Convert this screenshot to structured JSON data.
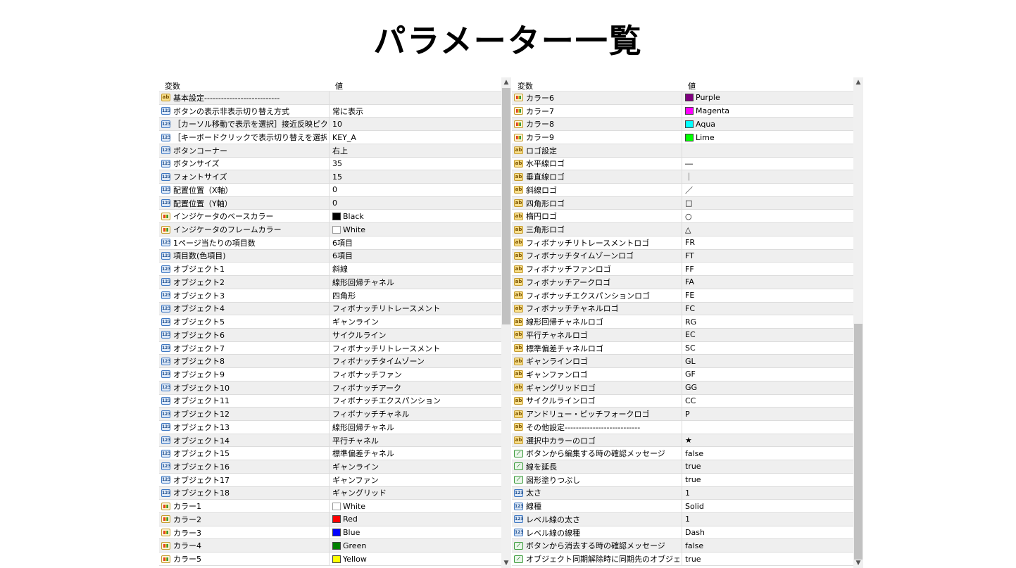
{
  "title": "パラメーター一覧",
  "header": {
    "col1": "変数",
    "col2": "値"
  },
  "left_rows": [
    {
      "icon": "ab",
      "name": "基本設定---------------------------",
      "value": ""
    },
    {
      "icon": "num",
      "name": "ボタンの表示非表示切り替え方式",
      "value": "常に表示"
    },
    {
      "icon": "num",
      "name": "［カーソル移動で表示を選択］接近反映ピク･..",
      "value": "10"
    },
    {
      "icon": "num",
      "name": "［キーボードクリックで表示切り替えを選択］キ･..",
      "value": "KEY_A"
    },
    {
      "icon": "num",
      "name": "ボタンコーナー",
      "value": "右上"
    },
    {
      "icon": "num",
      "name": "ボタンサイズ",
      "value": "35"
    },
    {
      "icon": "num",
      "name": "フォントサイズ",
      "value": "15"
    },
    {
      "icon": "num",
      "name": "配置位置（X軸）",
      "value": "0"
    },
    {
      "icon": "num",
      "name": "配置位置（Y軸）",
      "value": "0"
    },
    {
      "icon": "col",
      "name": "インジケータのベースカラー",
      "value": "Black",
      "swatch": "#000000"
    },
    {
      "icon": "col",
      "name": "インジケータのフレームカラー",
      "value": "White",
      "swatch": "#ffffff"
    },
    {
      "icon": "num",
      "name": "1ページ当たりの項目数",
      "value": "6項目"
    },
    {
      "icon": "num",
      "name": "項目数(色項目)",
      "value": "6項目"
    },
    {
      "icon": "num",
      "name": "オブジェクト1",
      "value": "斜線"
    },
    {
      "icon": "num",
      "name": "オブジェクト2",
      "value": "線形回帰チャネル"
    },
    {
      "icon": "num",
      "name": "オブジェクト3",
      "value": "四角形"
    },
    {
      "icon": "num",
      "name": "オブジェクト4",
      "value": "フィボナッチリトレースメント"
    },
    {
      "icon": "num",
      "name": "オブジェクト5",
      "value": "ギャンライン"
    },
    {
      "icon": "num",
      "name": "オブジェクト6",
      "value": "サイクルライン"
    },
    {
      "icon": "num",
      "name": "オブジェクト7",
      "value": "フィボナッチリトレースメント"
    },
    {
      "icon": "num",
      "name": "オブジェクト8",
      "value": "フィボナッチタイムゾーン"
    },
    {
      "icon": "num",
      "name": "オブジェクト9",
      "value": "フィボナッチファン"
    },
    {
      "icon": "num",
      "name": "オブジェクト10",
      "value": "フィボナッチアーク"
    },
    {
      "icon": "num",
      "name": "オブジェクト11",
      "value": "フィボナッチエクスパンション"
    },
    {
      "icon": "num",
      "name": "オブジェクト12",
      "value": "フィボナッチチャネル"
    },
    {
      "icon": "num",
      "name": "オブジェクト13",
      "value": "線形回帰チャネル"
    },
    {
      "icon": "num",
      "name": "オブジェクト14",
      "value": "平行チャネル"
    },
    {
      "icon": "num",
      "name": "オブジェクト15",
      "value": "標準偏差チャネル"
    },
    {
      "icon": "num",
      "name": "オブジェクト16",
      "value": "ギャンライン"
    },
    {
      "icon": "num",
      "name": "オブジェクト17",
      "value": "ギャンファン"
    },
    {
      "icon": "num",
      "name": "オブジェクト18",
      "value": "ギャングリッド"
    },
    {
      "icon": "col",
      "name": "カラー1",
      "value": "White",
      "swatch": "#ffffff"
    },
    {
      "icon": "col",
      "name": "カラー2",
      "value": "Red",
      "swatch": "#ff0000"
    },
    {
      "icon": "col",
      "name": "カラー3",
      "value": "Blue",
      "swatch": "#0000ff"
    },
    {
      "icon": "col",
      "name": "カラー4",
      "value": "Green",
      "swatch": "#008000"
    },
    {
      "icon": "col",
      "name": "カラー5",
      "value": "Yellow",
      "swatch": "#ffff00"
    }
  ],
  "right_rows": [
    {
      "icon": "col",
      "name": "カラー6",
      "value": "Purple",
      "swatch": "#800080"
    },
    {
      "icon": "col",
      "name": "カラー7",
      "value": "Magenta",
      "swatch": "#ff00ff"
    },
    {
      "icon": "col",
      "name": "カラー8",
      "value": "Aqua",
      "swatch": "#00ffff"
    },
    {
      "icon": "col",
      "name": "カラー9",
      "value": "Lime",
      "swatch": "#00ff00"
    },
    {
      "icon": "ab",
      "name": "ロゴ設定",
      "value": ""
    },
    {
      "icon": "ab",
      "name": "水平線ロゴ",
      "value": "―"
    },
    {
      "icon": "ab",
      "name": "垂直線ロゴ",
      "value": "｜"
    },
    {
      "icon": "ab",
      "name": "斜線ロゴ",
      "value": "／"
    },
    {
      "icon": "ab",
      "name": "四角形ロゴ",
      "value": "□"
    },
    {
      "icon": "ab",
      "name": "楕円ロゴ",
      "value": "○"
    },
    {
      "icon": "ab",
      "name": "三角形ロゴ",
      "value": "△"
    },
    {
      "icon": "ab",
      "name": "フィボナッチリトレースメントロゴ",
      "value": "FR"
    },
    {
      "icon": "ab",
      "name": "フィボナッチタイムゾーンロゴ",
      "value": "FT"
    },
    {
      "icon": "ab",
      "name": "フィボナッチファンロゴ",
      "value": "FF"
    },
    {
      "icon": "ab",
      "name": "フィボナッチアークロゴ",
      "value": "FA"
    },
    {
      "icon": "ab",
      "name": "フィボナッチエクスパンションロゴ",
      "value": "FE"
    },
    {
      "icon": "ab",
      "name": "フィボナッチチャネルロゴ",
      "value": "FC"
    },
    {
      "icon": "ab",
      "name": "線形回帰チャネルロゴ",
      "value": "RG"
    },
    {
      "icon": "ab",
      "name": "平行チャネルロゴ",
      "value": "EC"
    },
    {
      "icon": "ab",
      "name": "標準偏差チャネルロゴ",
      "value": "SC"
    },
    {
      "icon": "ab",
      "name": "ギャンラインロゴ",
      "value": "GL"
    },
    {
      "icon": "ab",
      "name": "ギャンファンロゴ",
      "value": "GF"
    },
    {
      "icon": "ab",
      "name": "ギャングリッドロゴ",
      "value": "GG"
    },
    {
      "icon": "ab",
      "name": "サイクルラインロゴ",
      "value": "CC"
    },
    {
      "icon": "ab",
      "name": "アンドリュー・ピッチフォークロゴ",
      "value": "P"
    },
    {
      "icon": "ab",
      "name": "その他設定---------------------------",
      "value": ""
    },
    {
      "icon": "ab",
      "name": "選択中カラーのロゴ",
      "value": "★"
    },
    {
      "icon": "bool",
      "name": "ボタンから編集する時の確認メッセージ",
      "value": "false"
    },
    {
      "icon": "bool",
      "name": "線を延長",
      "value": "true"
    },
    {
      "icon": "bool",
      "name": "図形塗りつぶし",
      "value": "true"
    },
    {
      "icon": "num",
      "name": "太さ",
      "value": "1"
    },
    {
      "icon": "num",
      "name": "線種",
      "value": "Solid"
    },
    {
      "icon": "num",
      "name": "レベル線の太さ",
      "value": "1"
    },
    {
      "icon": "num",
      "name": "レベル線の線種",
      "value": "Dash"
    },
    {
      "icon": "bool",
      "name": "ボタンから消去する時の確認メッセージ",
      "value": "false"
    },
    {
      "icon": "bool",
      "name": "オブジェクト同期解除時に同期先のオブジェクト･..",
      "value": "true"
    }
  ]
}
